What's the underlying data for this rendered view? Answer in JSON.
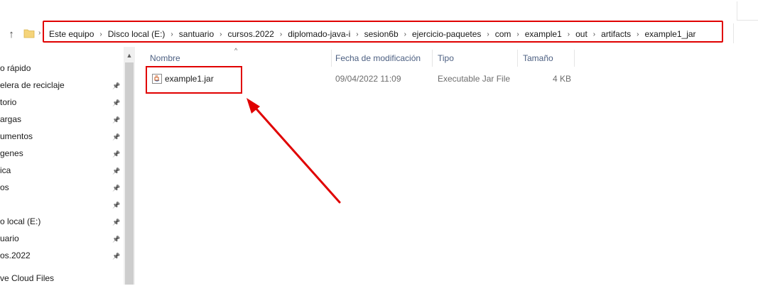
{
  "address": {
    "crumbs": [
      "Este equipo",
      "Disco local (E:)",
      "santuario",
      "cursos.2022",
      "diplomado-java-i",
      "sesion6b",
      "ejercicio-paquetes",
      "com",
      "example1",
      "out",
      "artifacts",
      "example1_jar"
    ]
  },
  "sidebar": {
    "items": [
      {
        "label": "o rápido",
        "pinned": false
      },
      {
        "label": "elera de reciclaje",
        "pinned": true
      },
      {
        "label": "torio",
        "pinned": true
      },
      {
        "label": "argas",
        "pinned": true
      },
      {
        "label": "umentos",
        "pinned": true
      },
      {
        "label": "genes",
        "pinned": true
      },
      {
        "label": "ica",
        "pinned": true
      },
      {
        "label": "os",
        "pinned": true
      },
      {
        "label": "",
        "pinned": true
      },
      {
        "label": "o local (E:)",
        "pinned": true
      },
      {
        "label": "uario",
        "pinned": true
      },
      {
        "label": "os.2022",
        "pinned": true
      },
      {
        "label": "ve Cloud Files",
        "pinned": false
      }
    ]
  },
  "columns": {
    "name": "Nombre",
    "modified": "Fecha de modificación",
    "type": "Tipo",
    "size": "Tamaño"
  },
  "files": [
    {
      "name": "example1.jar",
      "modified": "09/04/2022 11:09",
      "type": "Executable Jar File",
      "size": "4 KB",
      "icon": "jar-file-icon"
    }
  ],
  "colors": {
    "highlight": "#e00000",
    "header_text": "#4d6082"
  }
}
